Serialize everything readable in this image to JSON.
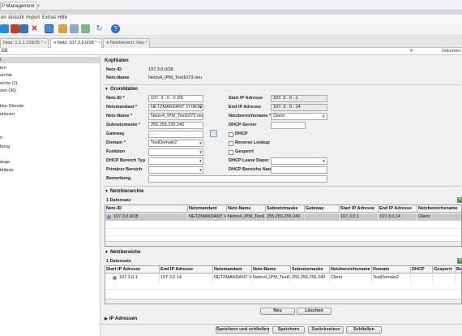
{
  "window": {
    "title_tab": "P Management",
    "close": "×"
  },
  "menu": {
    "items": [
      "en",
      "Ansicht",
      "Import",
      "Extras",
      "Hilfe"
    ]
  },
  "toolbar": {
    "icons": [
      "new-icon",
      "open-icon",
      "save-icon",
      "delete-icon",
      "print-icon",
      "paint-icon",
      "export-icon",
      "network-icon",
      "refresh-icon",
      "help-icon"
    ]
  },
  "tabs": [
    {
      "label": "Netz: 1.1.1.128/25 *"
    },
    {
      "label": "Netz: 107.3.0.0/28 *"
    },
    {
      "label": "Netzbereich: Neu *"
    }
  ],
  "address": {
    "value": "/28",
    "dokument_label": "Dokumen"
  },
  "sidebar": {
    "items": [
      "t",
      "ten",
      "archie",
      "eiche (1)",
      "sen (36)",
      "ktur Dienste",
      "otionen",
      "n",
      "bung",
      "änge",
      "ttribute"
    ]
  },
  "kopfdaten": {
    "title": "Kopfdaten",
    "netz_id_label": "Netz-ID",
    "netz_id_value": "107.3.0.0/28",
    "netz_name_label": "Netz-Name",
    "netz_name_value": "Netzv4_IPM_Test1073.neu"
  },
  "grunddaten": {
    "title": "Grunddaten",
    "netz_id_label": "Netz-ID *",
    "netz_id_value": "107. 3 . 0 . 0 /28",
    "netzmandant_label": "Netzmandant *",
    "netzmandant_value": "NETZMANDANT VI 08/2014",
    "netz_name_label": "Netz-Name *",
    "netz_name_value": "Netzv4_IPM_Test1073.neu",
    "subnetzmaske_label": "Subnetzmaske *",
    "subnetzmaske_value": "255.255.255.240",
    "gateway_label": "Gateway",
    "gateway_value": ".   .   .",
    "domain_label": "Domain *",
    "domain_value": "TestDomain2",
    "funktion_label": "Funktion",
    "dhcp_bereich_typ_label": "DHCP Bereich Typ",
    "primaerer_bereich_label": "Primärer Bereich",
    "bemerkung_label": "Bemerkung",
    "start_ip_label": "Start IP Adresse",
    "start_ip_value": "107. 3 . 0 . 1",
    "end_ip_label": "End IP Adresse",
    "end_ip_value": "107. 3 . 0 . 14",
    "netzbereichsname_label": "Netzbereichsname *",
    "netzbereichsname_value": "Client",
    "dhcp_server_label": "DHCP-Server",
    "dhcp_label": "DHCP",
    "reverse_lookup_label": "Reverse Lookup",
    "gesperrt_label": "Gesperrt",
    "dhcp_lease_label": "DHCP Lease Dauer",
    "dhcp_bereichs_name_label": "DHCP Bereichs Name"
  },
  "netzhierarchie": {
    "title": "Netzhierarchie",
    "count": "1 Datensatz",
    "columns": [
      "Netz-ID",
      "Netzmandant",
      "Netz-Name",
      "Subnetzmaske",
      "Gateway",
      "Start IP Adresse",
      "End IP Adresse",
      "Netzbereichsname"
    ],
    "rows": [
      [
        "107.3.0.0/28",
        "NETZMANDANT VI 0",
        "Netzv4_IPM_Test107",
        "255.255.255.240",
        "",
        "107.3.0.1",
        "107.3.0.14",
        "Client"
      ]
    ]
  },
  "netzbereiche": {
    "title": "Netzbereiche",
    "count": "1 Datensatz",
    "columns": [
      "Start IP Adresse",
      "End IP Adresse",
      "Netzmandant",
      "Netz-Name",
      "Subnetzmaske",
      "Netzbereichsname",
      "Domain",
      "DHCP",
      "Gesperrt",
      "Be"
    ],
    "rows": [
      [
        "107.3.0.1",
        "107.3.0.14",
        "NETZMANDANT VI 0",
        "Netzv4_IPM_Test107",
        "255.255.255.240",
        "Client",
        "TestDomain2",
        "",
        "",
        ""
      ]
    ],
    "neu_label": "Neu",
    "loeschen_label": "Löschen"
  },
  "ip_adressen": {
    "title": "IP Adressen"
  },
  "footer": {
    "save_close": "Speichern und schließen",
    "save": "Speichern",
    "reset": "Zurücksetzen",
    "close": "Schließen"
  }
}
